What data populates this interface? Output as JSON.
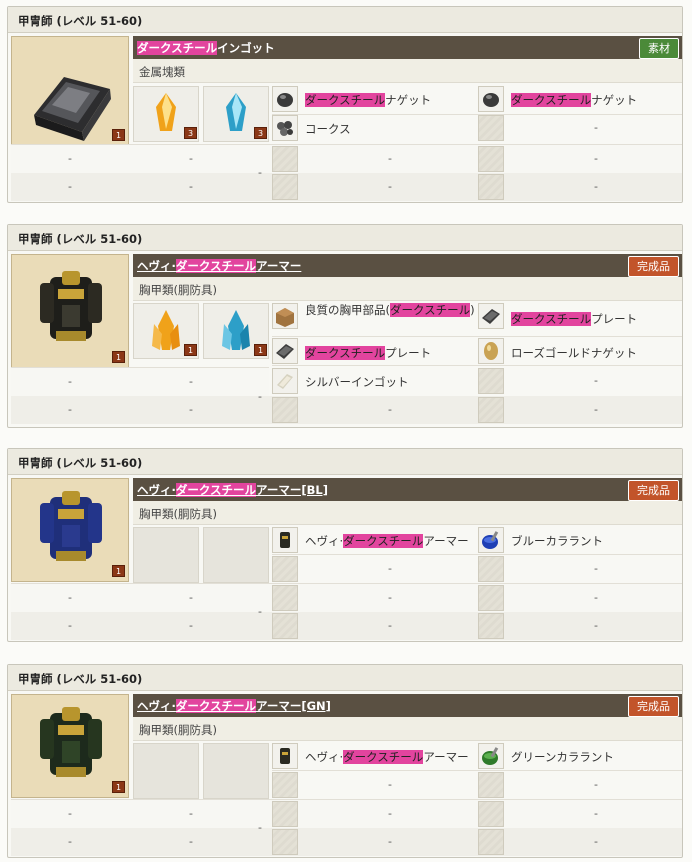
{
  "cards": [
    {
      "title": "甲冑師 (レベル 51-60)",
      "name_hl": "ダークスチール",
      "name_pre": "",
      "name_post": "インゴット",
      "tag": "素材",
      "tag_color": "#4b8a39",
      "category": "金属塊類",
      "qty": "1",
      "crystals": [
        {
          "qty": "3",
          "color": "orange"
        },
        {
          "qty": "3",
          "color": "blue"
        }
      ],
      "mats_left": [
        {
          "icon": "dark-nugget-icon",
          "hl": "ダークスチール",
          "text": "ナゲット"
        },
        {
          "icon": "coke-icon",
          "hl": "",
          "text": "コークス"
        }
      ],
      "mats_right": [
        {
          "icon": "dark-nugget-icon",
          "hl": "ダークスチール",
          "text": "ナゲット"
        },
        {
          "icon": "",
          "hl": "",
          "text": "-"
        }
      ]
    },
    {
      "title": "甲冑師 (レベル 51-60)",
      "name_hl": "ダークスチール",
      "name_pre": "ヘヴィ·",
      "name_post": "アーマー",
      "tag": "完成品",
      "tag_color": "#c2542a",
      "category": "胸甲類(胴防具)",
      "qty": "1",
      "crystals": [
        {
          "qty": "1",
          "color": "orange"
        },
        {
          "qty": "1",
          "color": "blue"
        }
      ],
      "mats_left": [
        {
          "icon": "parts-box-icon",
          "hl": "ダークスチール",
          "text": "良質の胸甲部品(",
          "text_after": ")"
        },
        {
          "icon": "plate-icon",
          "hl": "ダークスチール",
          "text": "プレート"
        },
        {
          "icon": "silver-ingot-icon",
          "hl": "",
          "text": "シルバーインゴット"
        }
      ],
      "mats_right": [
        {
          "icon": "plate-icon",
          "hl": "ダークスチール",
          "text": "プレート"
        },
        {
          "icon": "rose-gold-nugget-icon",
          "hl": "",
          "text": "ローズゴールドナゲット"
        },
        {
          "icon": "",
          "hl": "",
          "text": "-"
        }
      ]
    },
    {
      "title": "甲冑師 (レベル 51-60)",
      "name_hl": "ダークスチール",
      "name_pre": "ヘヴィ·",
      "name_post": "アーマー[BL]",
      "tag": "完成品",
      "tag_color": "#c2542a",
      "category": "胸甲類(胴防具)",
      "qty": "1",
      "mats_left": [
        {
          "icon": "armor-icon",
          "hl": "ダークスチール",
          "pre": "ヘヴィ·",
          "text": "アーマー"
        },
        {
          "icon": "",
          "hl": "",
          "text": "-"
        }
      ],
      "mats_right": [
        {
          "icon": "blue-dye-icon",
          "hl": "",
          "text": "ブルーカララント"
        },
        {
          "icon": "",
          "hl": "",
          "text": "-"
        }
      ]
    },
    {
      "title": "甲冑師 (レベル 51-60)",
      "name_hl": "ダークスチール",
      "name_pre": "ヘヴィ·",
      "name_post": "アーマー[GN]",
      "tag": "完成品",
      "tag_color": "#c2542a",
      "category": "胸甲類(胴防具)",
      "qty": "1",
      "mats_left": [
        {
          "icon": "armor-icon",
          "hl": "ダークスチール",
          "pre": "ヘヴィ·",
          "text": "アーマー"
        },
        {
          "icon": "",
          "hl": "",
          "text": "-"
        }
      ],
      "mats_right": [
        {
          "icon": "green-dye-icon",
          "hl": "",
          "text": "グリーンカララント"
        },
        {
          "icon": "",
          "hl": "",
          "text": "-"
        }
      ]
    }
  ],
  "dash": "-"
}
